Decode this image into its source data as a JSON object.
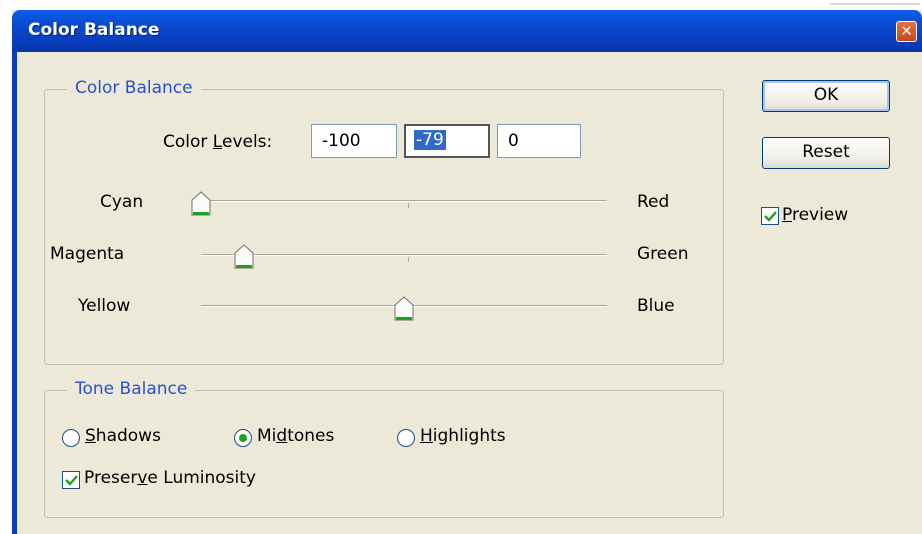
{
  "window": {
    "title": "Color Balance",
    "close_glyph": "✕",
    "colors": {
      "titlebar": "#0a4ad0",
      "face": "#ece9d8",
      "legend": "#2a50d0",
      "check": "#21a121"
    }
  },
  "color_balance": {
    "legend": "Color Balance",
    "levels_label_pre": "Color ",
    "levels_label_key": "L",
    "levels_label_post": "evels:",
    "levels": [
      "-100",
      "-79",
      "0"
    ],
    "sliders": [
      {
        "left": "Cyan",
        "right": "Red",
        "value": -100
      },
      {
        "left": "Magenta",
        "right": "Green",
        "value": -79
      },
      {
        "left": "Yellow",
        "right": "Blue",
        "value": 0
      }
    ],
    "slider_range": [
      -100,
      100
    ]
  },
  "tone_balance": {
    "legend": "Tone Balance",
    "options": [
      {
        "key": "S",
        "rest": "hadows",
        "selected": false
      },
      {
        "pre": "Mi",
        "key": "d",
        "rest": "tones",
        "selected": true
      },
      {
        "key": "H",
        "rest": "ighlights",
        "selected": false
      }
    ],
    "preserve_pre": "Preser",
    "preserve_key": "v",
    "preserve_post": "e Luminosity",
    "preserve_checked": true
  },
  "buttons": {
    "ok": "OK",
    "reset": "Reset",
    "preview_key": "P",
    "preview_rest": "review",
    "preview_checked": true
  },
  "icons": {
    "close": "close-icon",
    "check": "checkmark-icon",
    "thumb": "slider-thumb-icon"
  }
}
